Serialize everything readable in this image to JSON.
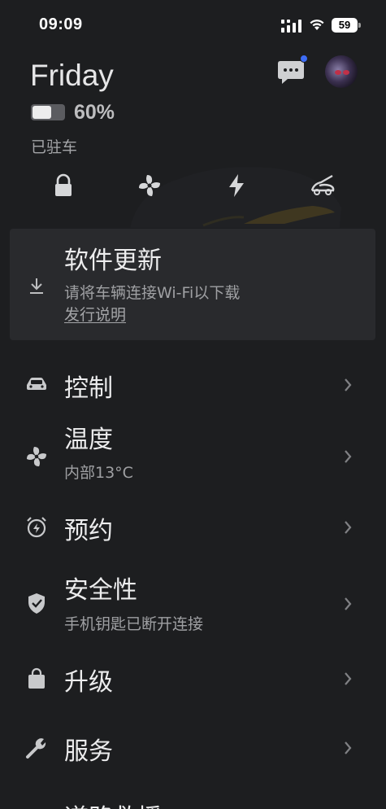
{
  "status_bar": {
    "time": "09:09",
    "battery": "59"
  },
  "header": {
    "car_name": "Friday",
    "battery_percent": "60%",
    "battery_level": 0.6,
    "park_status": "已驻车"
  },
  "quick_actions": [
    {
      "icon": "lock-icon"
    },
    {
      "icon": "fan-icon"
    },
    {
      "icon": "lightning-icon"
    },
    {
      "icon": "frunk-icon"
    }
  ],
  "update_card": {
    "title": "软件更新",
    "description": "请将车辆连接Wi-Fi以下载",
    "link": "发行说明",
    "icon": "download-icon"
  },
  "menu": [
    {
      "title": "控制",
      "subtitle": "",
      "icon": "car-icon"
    },
    {
      "title": "温度",
      "subtitle": "内部13°C",
      "icon": "fan-icon"
    },
    {
      "title": "预约",
      "subtitle": "",
      "icon": "alarm-icon"
    },
    {
      "title": "安全性",
      "subtitle": "手机钥匙已断开连接",
      "icon": "shield-icon"
    },
    {
      "title": "升级",
      "subtitle": "",
      "icon": "bag-icon"
    },
    {
      "title": "服务",
      "subtitle": "",
      "icon": "wrench-icon"
    },
    {
      "title": "道路救援",
      "subtitle": "",
      "icon": "roadside-icon"
    }
  ],
  "colors": {
    "background": "#1d1e20",
    "card": "#292a2d",
    "notification_dot": "#3d6cf5",
    "text": "#ececed",
    "muted": "#9fa0a3"
  }
}
